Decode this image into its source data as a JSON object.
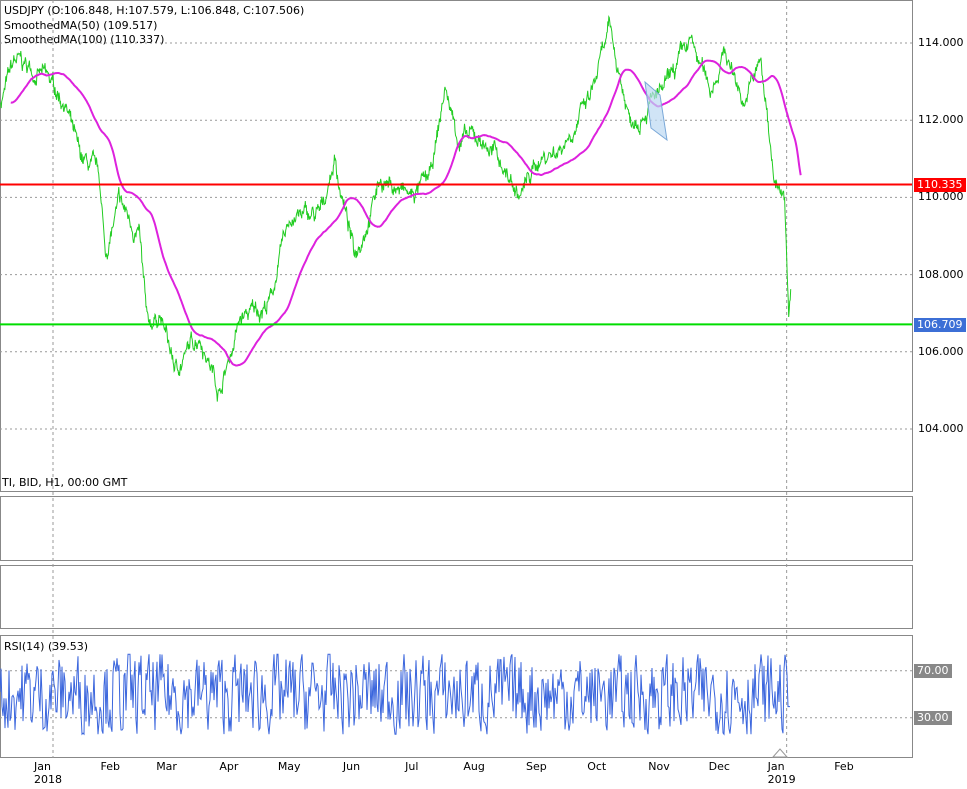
{
  "header": {
    "symbol_line": "USDJPY (O:106.848, H:107.579, L:106.848, C:107.506)",
    "ma50": "SmoothedMA(50) (109.517)",
    "ma100": "SmoothedMA(100) (110.337)",
    "source": "TI, BID, H1, 00:00 GMT"
  },
  "rsi": {
    "label": "RSI(14) (39.53)",
    "levels": [
      "70.00",
      "30.00"
    ]
  },
  "lines": {
    "red": "110.335",
    "green": "106.709"
  },
  "colors": {
    "price": "#22cc22",
    "ma": "#dd22dd",
    "red": "#ff0000",
    "green": "#00dd00",
    "rsi": "#3b66dd",
    "tag_blue": "#3c6fd6"
  },
  "price_axis": [
    "114.000",
    "112.000",
    "110.000",
    "108.000",
    "106.000",
    "104.000"
  ],
  "x_axis": [
    {
      "m": "Jan",
      "y": "2018",
      "d": 0
    },
    {
      "m": "Feb",
      "d": 31
    },
    {
      "m": "Mar",
      "d": 59
    },
    {
      "m": "Apr",
      "d": 90
    },
    {
      "m": "May",
      "d": 120
    },
    {
      "m": "Jun",
      "d": 151
    },
    {
      "m": "Jul",
      "d": 181
    },
    {
      "m": "Aug",
      "d": 212
    },
    {
      "m": "Sep",
      "d": 243
    },
    {
      "m": "Oct",
      "d": 273
    },
    {
      "m": "Nov",
      "d": 304
    },
    {
      "m": "Dec",
      "d": 334
    },
    {
      "m": "Jan",
      "y": "2019",
      "d": 365
    },
    {
      "m": "Feb",
      "d": 396
    }
  ],
  "chart_data": {
    "type": "line",
    "title": "USDJPY H1",
    "ylim": [
      102.3,
      114.9
    ],
    "x_unit": "days since 2018-01-01",
    "price": [
      [
        -26,
        112.5
      ],
      [
        -19,
        113.5
      ],
      [
        -6,
        113.2
      ],
      [
        6,
        112.5
      ],
      [
        13,
        111
      ],
      [
        23,
        110.5
      ],
      [
        26,
        108.5
      ],
      [
        33,
        109.8
      ],
      [
        43,
        109
      ],
      [
        47,
        106.5
      ],
      [
        53,
        107
      ],
      [
        61,
        105.5
      ],
      [
        73,
        106.5
      ],
      [
        83,
        105
      ],
      [
        93,
        106.8
      ],
      [
        108,
        107.3
      ],
      [
        118,
        109.5
      ],
      [
        133,
        109.5
      ],
      [
        140,
        111
      ],
      [
        150,
        108.5
      ],
      [
        163,
        110.5
      ],
      [
        178,
        110
      ],
      [
        188,
        110.5
      ],
      [
        195,
        112.8
      ],
      [
        202,
        111.5
      ],
      [
        213,
        111.5
      ],
      [
        222,
        111
      ],
      [
        232,
        110
      ],
      [
        242,
        111
      ],
      [
        252,
        111.3
      ],
      [
        267,
        112.5
      ],
      [
        277,
        114.3
      ],
      [
        287,
        112
      ],
      [
        297,
        112.5
      ],
      [
        304,
        112.7
      ],
      [
        317,
        114
      ],
      [
        327,
        112.8
      ],
      [
        334,
        113.8
      ],
      [
        344,
        112.5
      ],
      [
        352,
        113.5
      ],
      [
        359,
        110.5
      ],
      [
        364,
        109.8
      ],
      [
        366,
        106.8
      ],
      [
        367,
        107.5
      ]
    ],
    "rsi_range": [
      0,
      100
    ],
    "rsi_levels": [
      70,
      30
    ]
  }
}
